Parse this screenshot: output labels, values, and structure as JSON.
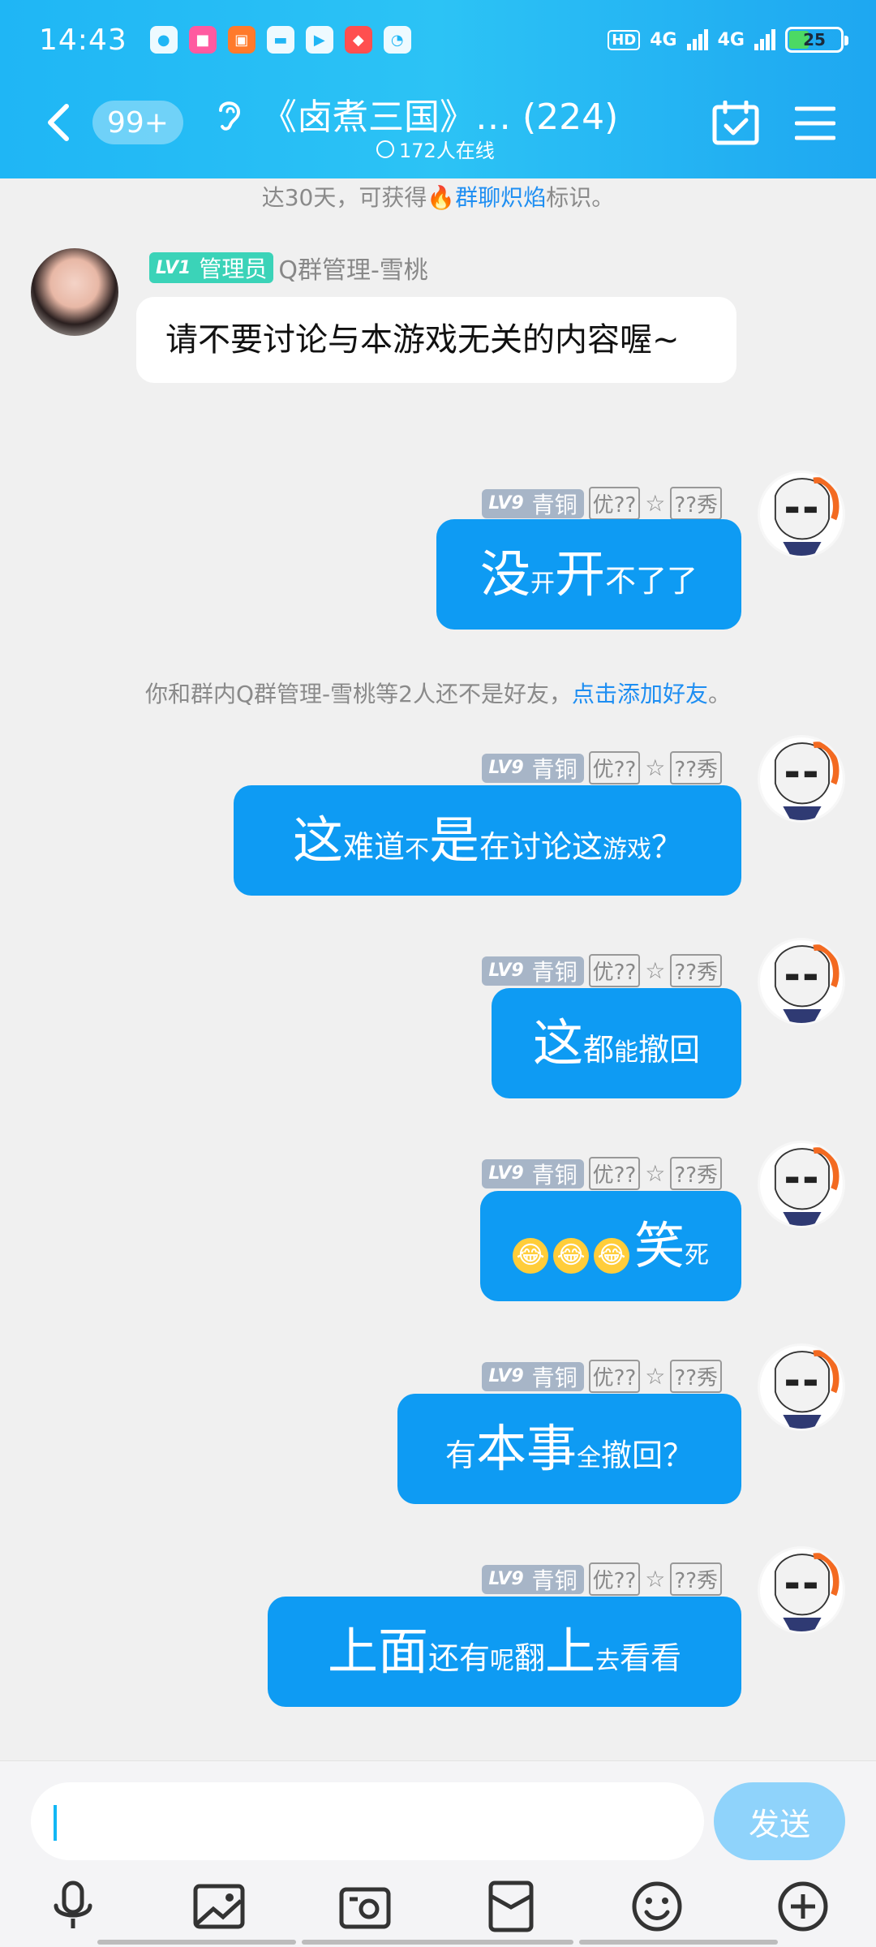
{
  "status": {
    "time": "14:43",
    "hd": "HD",
    "net1": "4G",
    "net2": "4G",
    "battery": "25"
  },
  "header": {
    "badge": "99+",
    "title": "《卤煮三国》… (224)",
    "online": "172人在线"
  },
  "chat": {
    "top_note_pre": "达30天，可获得",
    "top_note_link": "群聊炽焰",
    "top_note_post": "标识。",
    "admin_msg": {
      "level": "LV1",
      "role": "管理员",
      "name": "Q群管理-雪桃",
      "text": "请不要讨论与本游戏无关的内容喔~"
    },
    "my_meta": {
      "level": "LV9",
      "rank": "青铜",
      "t1": "优??",
      "star": "☆",
      "t2": "??秀"
    },
    "friend_note_pre": "你和群内Q群管理-雪桃等2人还不是好友，",
    "friend_note_link": "点击添加好友",
    "friend_note_post": "。",
    "messages": [
      {
        "parts": [
          [
            "没",
            "l"
          ],
          [
            "开",
            "s"
          ],
          [
            " 开",
            "l"
          ],
          [
            "不了了",
            "m"
          ]
        ]
      },
      {
        "parts": [
          [
            "这",
            "l"
          ],
          [
            "难道",
            "m"
          ],
          [
            "不",
            "s"
          ],
          [
            "是",
            "l"
          ],
          [
            "在讨论这",
            "m"
          ],
          [
            "游戏",
            "s"
          ],
          [
            "？",
            "m"
          ]
        ]
      },
      {
        "parts": [
          [
            "这",
            "l"
          ],
          [
            "都",
            "m"
          ],
          [
            "能",
            "s"
          ],
          [
            "撤回",
            "m"
          ]
        ]
      },
      {
        "parts": [
          [
            "笑",
            "l"
          ],
          [
            "死",
            "s"
          ]
        ],
        "emojis": [
          "😂",
          "😂",
          "😂"
        ]
      },
      {
        "parts": [
          [
            "有",
            "m"
          ],
          [
            "本事",
            "l"
          ],
          [
            "全",
            "s"
          ],
          [
            "撤回？",
            "m"
          ]
        ]
      },
      {
        "parts": [
          [
            "上面",
            "l"
          ],
          [
            "还有",
            "m"
          ],
          [
            "呢",
            "s"
          ],
          [
            " 翻",
            "m"
          ],
          [
            "上",
            "l"
          ],
          [
            "去",
            "s"
          ],
          [
            "看看",
            "m"
          ]
        ]
      }
    ]
  },
  "input": {
    "placeholder": "",
    "send": "发送"
  },
  "icons": [
    "back-icon",
    "ear-icon",
    "calendar-check-icon",
    "menu-icon",
    "mic-icon",
    "image-icon",
    "camera-icon",
    "red-packet-icon",
    "emoji-icon",
    "plus-icon"
  ]
}
